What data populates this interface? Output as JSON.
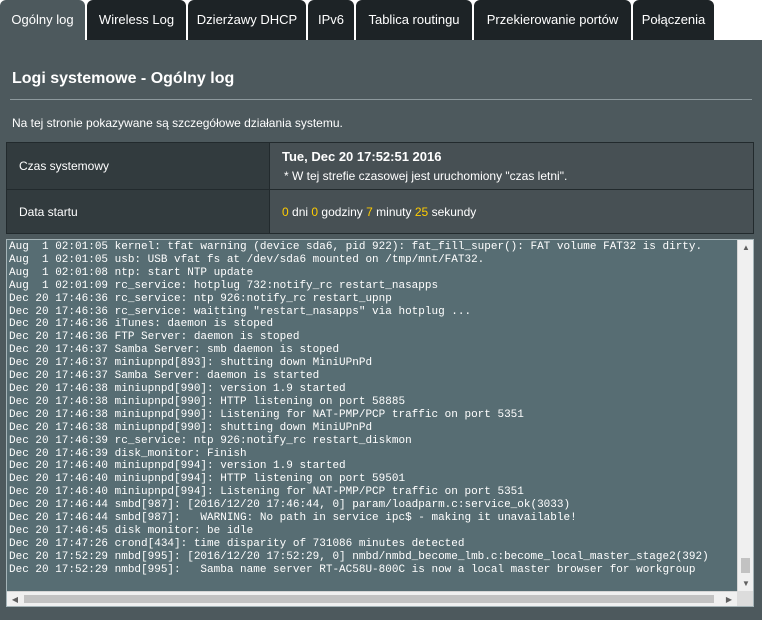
{
  "tabs": [
    {
      "label": "Ogólny log",
      "active": true
    },
    {
      "label": "Wireless Log"
    },
    {
      "label": "Dzierżawy DHCP"
    },
    {
      "label": "IPv6"
    },
    {
      "label": "Tablica routingu"
    },
    {
      "label": "Przekierowanie portów"
    },
    {
      "label": "Połączenia"
    }
  ],
  "page": {
    "title": "Logi systemowe - Ogólny log",
    "description": "Na tej stronie pokazywane są szczegółowe działania systemu."
  },
  "system_time": {
    "label": "Czas systemowy",
    "value": "Tue, Dec 20 17:52:51 2016",
    "note": "* W tej strefie czasowej jest uruchomiony \"czas letni\"."
  },
  "uptime": {
    "label": "Data startu",
    "days": "0",
    "days_label": "dni",
    "hours": "0",
    "hours_label": "godziny",
    "minutes": "7",
    "minutes_label": "minuty",
    "seconds": "25",
    "seconds_label": "sekundy"
  },
  "log": {
    "lines": [
      "Aug  1 02:01:05 kernel: tfat warning (device sda6, pid 922): fat_fill_super(): FAT volume FAT32 is dirty.",
      "Aug  1 02:01:05 usb: USB vfat fs at /dev/sda6 mounted on /tmp/mnt/FAT32.",
      "Aug  1 02:01:08 ntp: start NTP update",
      "Aug  1 02:01:09 rc_service: hotplug 732:notify_rc restart_nasapps",
      "Dec 20 17:46:36 rc_service: ntp 926:notify_rc restart_upnp",
      "Dec 20 17:46:36 rc_service: waitting \"restart_nasapps\" via hotplug ...",
      "Dec 20 17:46:36 iTunes: daemon is stoped",
      "Dec 20 17:46:36 FTP Server: daemon is stoped",
      "Dec 20 17:46:37 Samba Server: smb daemon is stoped",
      "Dec 20 17:46:37 miniupnpd[893]: shutting down MiniUPnPd",
      "Dec 20 17:46:37 Samba Server: daemon is started",
      "Dec 20 17:46:38 miniupnpd[990]: version 1.9 started",
      "Dec 20 17:46:38 miniupnpd[990]: HTTP listening on port 58885",
      "Dec 20 17:46:38 miniupnpd[990]: Listening for NAT-PMP/PCP traffic on port 5351",
      "Dec 20 17:46:38 miniupnpd[990]: shutting down MiniUPnPd",
      "Dec 20 17:46:39 rc_service: ntp 926:notify_rc restart_diskmon",
      "Dec 20 17:46:39 disk_monitor: Finish",
      "Dec 20 17:46:40 miniupnpd[994]: version 1.9 started",
      "Dec 20 17:46:40 miniupnpd[994]: HTTP listening on port 59501",
      "Dec 20 17:46:40 miniupnpd[994]: Listening for NAT-PMP/PCP traffic on port 5351",
      "Dec 20 17:46:44 smbd[987]: [2016/12/20 17:46:44, 0] param/loadparm.c:service_ok(3033)",
      "Dec 20 17:46:44 smbd[987]:   WARNING: No path in service ipc$ - making it unavailable!",
      "Dec 20 17:46:45 disk monitor: be idle",
      "Dec 20 17:47:26 crond[434]: time disparity of 731086 minutes detected",
      "Dec 20 17:52:29 nmbd[995]: [2016/12/20 17:52:29, 0] nmbd/nmbd_become_lmb.c:become_local_master_stage2(392)",
      "Dec 20 17:52:29 nmbd[995]:   Samba name server RT-AC58U-800C is now a local master browser for workgroup"
    ]
  },
  "colors": {
    "panel_bg": "#4d595d",
    "tab_bg": "#1d2326",
    "highlight_number": "#ffcc00",
    "log_bg": "#576d73"
  },
  "icons": {
    "scroll_up": "▲",
    "scroll_down": "▼",
    "scroll_left": "◀",
    "scroll_right": "▶"
  }
}
